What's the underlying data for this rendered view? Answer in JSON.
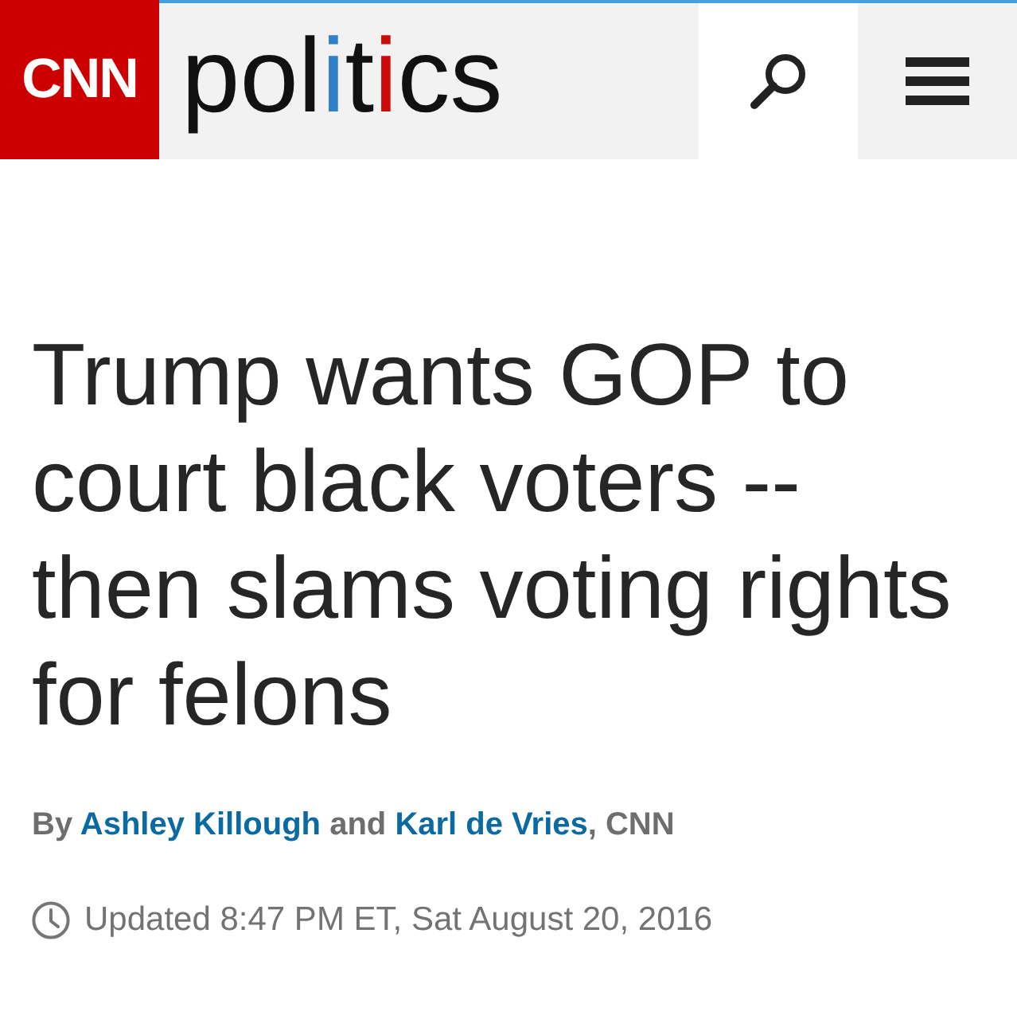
{
  "header": {
    "logo": {
      "text": "CNN"
    },
    "section": [
      {
        "text": "pol"
      },
      {
        "text": "i",
        "color": "#2f80c8"
      },
      {
        "text": "t"
      },
      {
        "text": "i",
        "color": "#cc0a0a"
      },
      {
        "text": "cs"
      }
    ],
    "buttons": [
      {
        "kind": "search"
      },
      {
        "kind": "menu"
      }
    ]
  },
  "article": {
    "headline": "Trump wants GOP to court black voters -- then slams voting rights for felons",
    "byline": [
      {
        "kind": "text",
        "text": "By "
      },
      {
        "kind": "author",
        "text": "Ashley Killough"
      },
      {
        "kind": "text",
        "text": " and "
      },
      {
        "kind": "author",
        "text": "Karl de Vries"
      },
      {
        "kind": "text",
        "text": ", CNN"
      }
    ],
    "timestamp": "Updated 8:47 PM ET, Sat August 20, 2016"
  }
}
